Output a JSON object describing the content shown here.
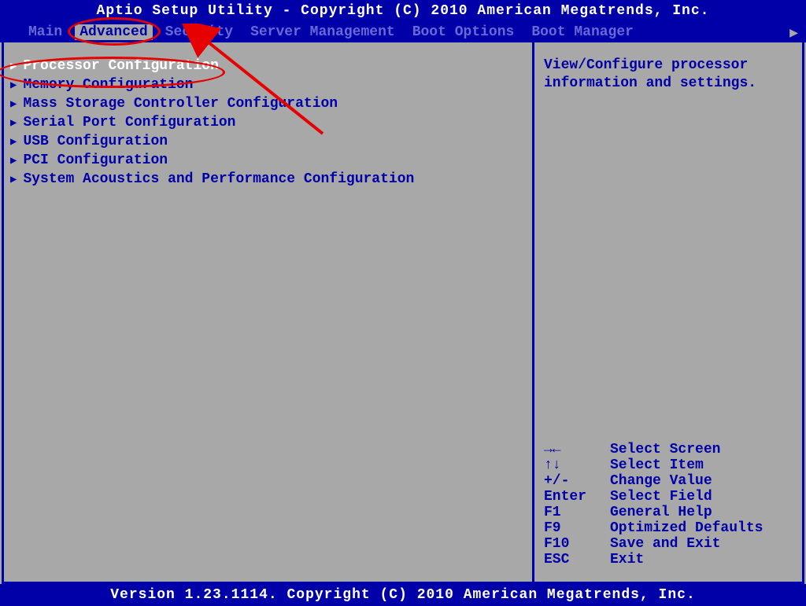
{
  "header": {
    "title": "Aptio Setup Utility - Copyright (C) 2010 American Megatrends, Inc."
  },
  "menu": {
    "items": [
      {
        "label": "Main"
      },
      {
        "label": "Advanced"
      },
      {
        "label": "Security"
      },
      {
        "label": "Server Management"
      },
      {
        "label": "Boot Options"
      },
      {
        "label": "Boot Manager"
      }
    ],
    "arrow": "▶"
  },
  "left_panel": {
    "items": [
      {
        "label": "Processor Configuration"
      },
      {
        "label": "Memory Configuration"
      },
      {
        "label": "Mass Storage Controller Configuration"
      },
      {
        "label": "Serial Port Configuration"
      },
      {
        "label": "USB Configuration"
      },
      {
        "label": "PCI Configuration"
      },
      {
        "label": "System Acoustics and Performance Configuration"
      }
    ]
  },
  "right_panel": {
    "help_text_line1": "View/Configure processor",
    "help_text_line2": "information and settings.",
    "hints": [
      {
        "key": "→←",
        "action": "Select Screen"
      },
      {
        "key": "↑↓",
        "action": "Select Item"
      },
      {
        "key": "+/-",
        "action": "Change Value"
      },
      {
        "key": "Enter",
        "action": "Select Field"
      },
      {
        "key": "F1",
        "action": "General Help"
      },
      {
        "key": "F9",
        "action": "Optimized Defaults"
      },
      {
        "key": "F10",
        "action": "Save and Exit"
      },
      {
        "key": "ESC",
        "action": "Exit"
      }
    ]
  },
  "footer": {
    "text": "Version 1.23.1114. Copyright (C) 2010 American Megatrends, Inc."
  },
  "icons": {
    "right_triangle": "▶"
  }
}
